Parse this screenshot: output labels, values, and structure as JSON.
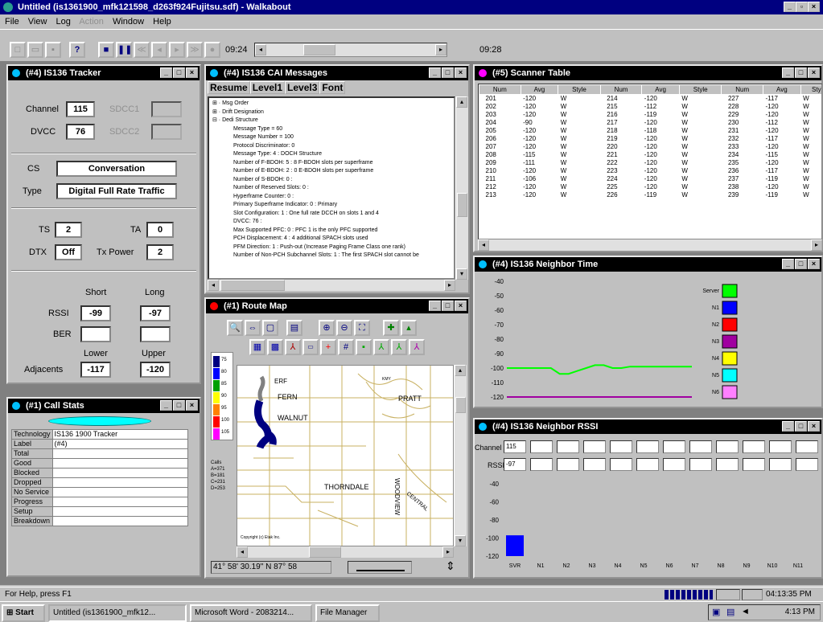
{
  "app": {
    "title": "Untitled (is1361900_mfk121598_d263f924Fujitsu.sdf) - Walkabout"
  },
  "menu": [
    "File",
    "View",
    "Log",
    "Action",
    "Window",
    "Help"
  ],
  "toolbar": {
    "start_time": "09:24",
    "end_time": "09:28"
  },
  "tracker": {
    "title": "(#4) IS136 Tracker",
    "channel_label": "Channel",
    "channel": "115",
    "sdcc1_label": "SDCC1",
    "dvcc_label": "DVCC",
    "dvcc": "76",
    "sdcc2_label": "SDCC2",
    "cs_label": "CS",
    "cs": "Conversation",
    "type_label": "Type",
    "type": "Digital Full Rate Traffic",
    "ts_label": "TS",
    "ts": "2",
    "ta_label": "TA",
    "ta": "0",
    "dtx_label": "DTX",
    "dtx": "Off",
    "txp_label": "Tx Power",
    "txp": "2",
    "short_label": "Short",
    "long_label": "Long",
    "rssi_label": "RSSI",
    "rssi_short": "-99",
    "rssi_long": "-97",
    "ber_label": "BER",
    "lower_label": "Lower",
    "upper_label": "Upper",
    "adj_label": "Adjacents",
    "adj_lower": "-117",
    "adj_upper": "-120"
  },
  "callstats": {
    "title": "(#1) Call Stats",
    "rows": [
      [
        "Technology",
        "IS136 1900 Tracker"
      ],
      [
        "Label",
        "(#4)"
      ],
      [
        "Total",
        ""
      ],
      [
        "Good",
        ""
      ],
      [
        "Blocked",
        ""
      ],
      [
        "Dropped",
        ""
      ],
      [
        "No Service",
        ""
      ],
      [
        "Progress",
        ""
      ],
      [
        "Setup",
        ""
      ],
      [
        "Breakdown",
        ""
      ]
    ]
  },
  "cai": {
    "title": "(#4) IS136 CAI Messages",
    "buttons": [
      "Resume",
      "Level1",
      "Level3",
      "Font"
    ],
    "lines": [
      "⊞ · Msg Order",
      "⊞ · Drift Designation",
      "⊟ · Dedi Structure",
      "Message Type = 60",
      "Message Number = 100",
      "Protocol Discriminator: 0",
      "Message Type: 4 : DOCH Structure",
      "Number of F-BDOH: 5 : 8 F-BDOH slots per superframe",
      "Number of E-BDOH: 2 : 0 E-BDOH slots per superframe",
      "Number of S-BDOH: 0 :",
      "Number of Reserved Slots: 0 :",
      "Hyperframe Counter: 0 :",
      "Primary Superframe Indicator: 0 : Primary",
      "Slot Configuration: 1 : One full rate DCCH on slots 1 and 4",
      "DVCC: 76 :",
      "Max Supported PFC: 0 : PFC 1 is the only PFC supported",
      "PCH Displacement: 4 : 4 additional SPACH slots used",
      "PFM Direction: 1 : Push-out (Increase Paging Frame Class one rank)",
      "Number of Non-PCH Subchannel Slots: 1 : The first SPACH slot cannot be"
    ]
  },
  "scanner": {
    "title": "(#5) Scanner Table",
    "headers": [
      "Num",
      "Avg",
      "Style",
      "Num",
      "Avg",
      "Style",
      "Num",
      "Avg",
      "Sty"
    ],
    "rows": [
      [
        "201",
        "-120",
        "W",
        "214",
        "-120",
        "W",
        "227",
        "-117",
        "W"
      ],
      [
        "202",
        "-120",
        "W",
        "215",
        "-112",
        "W",
        "228",
        "-120",
        "W"
      ],
      [
        "203",
        "-120",
        "W",
        "216",
        "-119",
        "W",
        "229",
        "-120",
        "W"
      ],
      [
        "204",
        "-90",
        "W",
        "217",
        "-120",
        "W",
        "230",
        "-112",
        "W"
      ],
      [
        "205",
        "-120",
        "W",
        "218",
        "-118",
        "W",
        "231",
        "-120",
        "W"
      ],
      [
        "206",
        "-120",
        "W",
        "219",
        "-120",
        "W",
        "232",
        "-117",
        "W"
      ],
      [
        "207",
        "-120",
        "W",
        "220",
        "-120",
        "W",
        "233",
        "-120",
        "W"
      ],
      [
        "208",
        "-115",
        "W",
        "221",
        "-120",
        "W",
        "234",
        "-115",
        "W"
      ],
      [
        "209",
        "-111",
        "W",
        "222",
        "-120",
        "W",
        "235",
        "-120",
        "W"
      ],
      [
        "210",
        "-120",
        "W",
        "223",
        "-120",
        "W",
        "236",
        "-117",
        "W"
      ],
      [
        "211",
        "-106",
        "W",
        "224",
        "-120",
        "W",
        "237",
        "-119",
        "W"
      ],
      [
        "212",
        "-120",
        "W",
        "225",
        "-120",
        "W",
        "238",
        "-120",
        "W"
      ],
      [
        "213",
        "-120",
        "W",
        "226",
        "-119",
        "W",
        "239",
        "-119",
        "W"
      ]
    ]
  },
  "ntime": {
    "title": "(#4) IS136 Neighbor Time",
    "yticks": [
      "-40",
      "-50",
      "-60",
      "-70",
      "-80",
      "-90",
      "-100",
      "-110",
      "-120"
    ],
    "legend": [
      {
        "name": "Server",
        "color": "#00ff00"
      },
      {
        "name": "N1",
        "color": "#0000ff"
      },
      {
        "name": "N2",
        "color": "#ff0000"
      },
      {
        "name": "N3",
        "color": "#a000a0"
      },
      {
        "name": "N4",
        "color": "#ffff00"
      },
      {
        "name": "N5",
        "color": "#00ffff"
      },
      {
        "name": "N6",
        "color": "#ff80ff"
      }
    ]
  },
  "routemap": {
    "title": "(#1) Route Map",
    "scale": [
      "75",
      "80",
      "85",
      "90",
      "95",
      "100",
      "105"
    ],
    "streets": [
      "FERN",
      "PRATT",
      "WALNUT",
      "THORNDALE",
      "WOODVIEW",
      "CENTRAL"
    ],
    "copyright": "Copyright (c) Etak Inc.",
    "coords": "41° 58' 30.19\" N 87° 58",
    "infobox": "Calls A=371 B=181 C=231 D=253"
  },
  "nrssi": {
    "title": "(#4) IS136 Neighbor RSSI",
    "channel_label": "Channel",
    "channel": "115",
    "rssi_label": "RSSI",
    "rssi": "-97",
    "yticks": [
      "-40",
      "-60",
      "-80",
      "-100",
      "-120"
    ],
    "xlabels": [
      "SVR",
      "N1",
      "N2",
      "N3",
      "N4",
      "N5",
      "N6",
      "N7",
      "N8",
      "N9",
      "N10",
      "N11"
    ]
  },
  "status": {
    "help": "For Help, press F1",
    "time": "04:13:35 PM"
  },
  "taskbar": {
    "start": "Start",
    "items": [
      "Untitled (is1361900_mfk12...",
      "Microsoft Word - 2083214...",
      "File Manager"
    ],
    "clock": "4:13 PM"
  },
  "chart_data": [
    {
      "type": "line",
      "title": "(#4) IS136 Neighbor Time",
      "ylim": [
        -120,
        -40
      ],
      "series": [
        {
          "name": "Server",
          "color": "#00ff00",
          "values": [
            -100,
            -100,
            -100,
            -100,
            -100,
            -100,
            -104,
            -104,
            -102,
            -100,
            -98,
            -98,
            -100,
            -100,
            -99,
            -99,
            -99,
            -99,
            -99,
            -99,
            -99,
            -99
          ]
        },
        {
          "name": "N3",
          "color": "#a000a0",
          "values": [
            -120,
            -120,
            -120,
            -120,
            -120,
            -120,
            -120,
            -120,
            -120,
            -120,
            -120,
            -120,
            -120,
            -120,
            -120,
            -120,
            -120,
            -120,
            -120,
            -120,
            -120,
            -120
          ]
        }
      ]
    },
    {
      "type": "bar",
      "title": "(#4) IS136 Neighbor RSSI",
      "categories": [
        "SVR",
        "N1",
        "N2",
        "N3",
        "N4",
        "N5",
        "N6",
        "N7",
        "N8",
        "N9",
        "N10",
        "N11"
      ],
      "values": [
        -97,
        null,
        null,
        null,
        null,
        null,
        null,
        null,
        null,
        null,
        null,
        null
      ],
      "ylim": [
        -120,
        -40
      ]
    }
  ]
}
